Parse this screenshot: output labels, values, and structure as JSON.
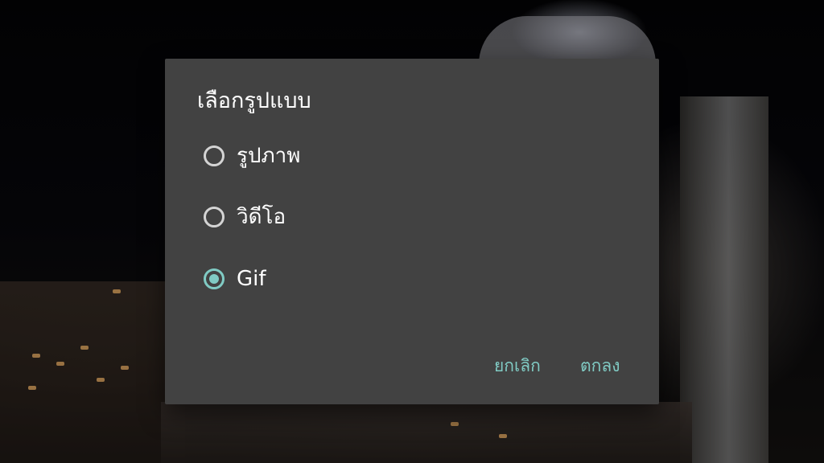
{
  "dialog": {
    "title": "เลือกรูปแบบ",
    "options": [
      {
        "label": "รูปภาพ",
        "selected": false
      },
      {
        "label": "วิดีโอ",
        "selected": false
      },
      {
        "label": "Gif",
        "selected": true
      }
    ],
    "actions": {
      "cancel_label": "ยกเลิก",
      "ok_label": "ตกลง"
    }
  },
  "colors": {
    "dialog_background": "#424242",
    "accent": "#80cbc4",
    "radio_unchecked": "#d4d4d4",
    "text_primary": "#ffffff"
  },
  "icons": {
    "radio_unchecked": "radio-unchecked-icon",
    "radio_checked": "radio-checked-icon"
  }
}
